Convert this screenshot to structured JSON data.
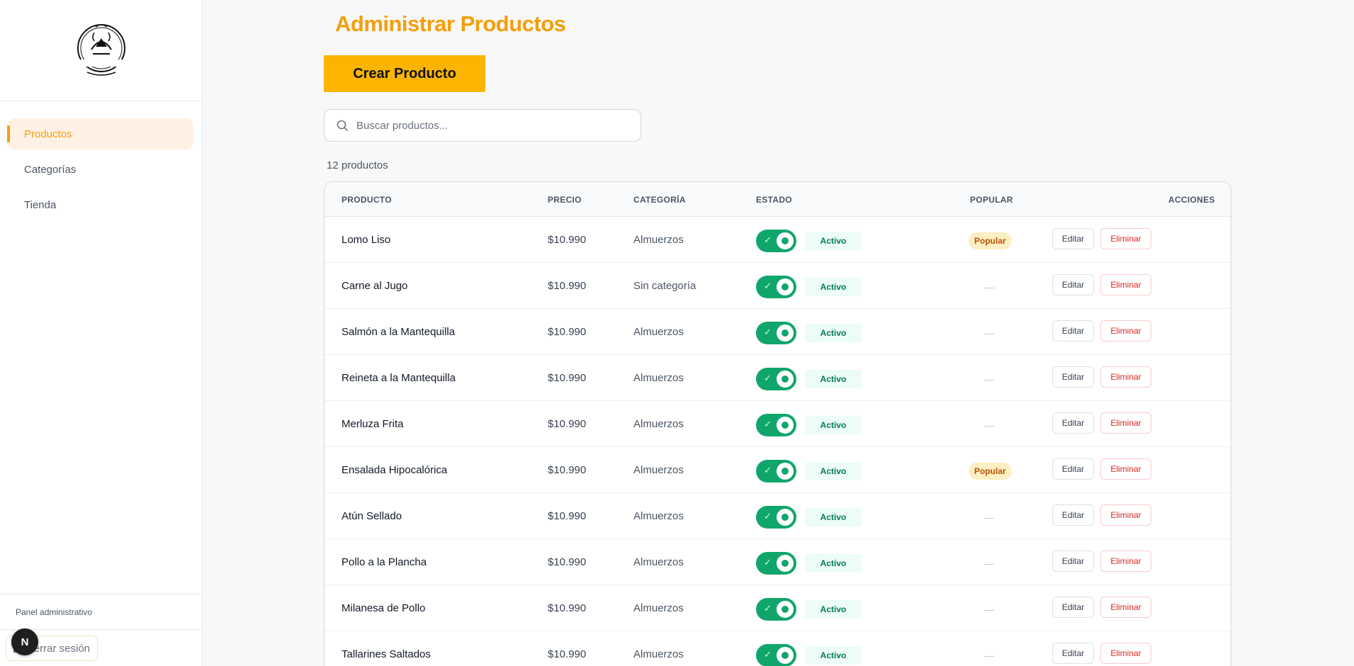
{
  "sidebar": {
    "logo_text": "RESTAURANT & BAR",
    "nav": [
      {
        "label": "Productos",
        "active": true
      },
      {
        "label": "Categorías",
        "active": false
      },
      {
        "label": "Tienda",
        "active": false
      }
    ],
    "footer_label": "Panel administrativo",
    "logout_label": "Cerrar sesión",
    "dev_badge": "N"
  },
  "header": {
    "title": "Administrar Productos",
    "create_label": "Crear Producto"
  },
  "search": {
    "placeholder": "Buscar productos...",
    "value": ""
  },
  "count_label": "12 productos",
  "table": {
    "columns": [
      "PRODUCTO",
      "PRECIO",
      "CATEGORÍA",
      "ESTADO",
      "POPULAR",
      "ACCIONES"
    ],
    "edit_label": "Editar",
    "delete_label": "Eliminar",
    "popular_label": "Popular",
    "empty_mark": "—",
    "rows": [
      {
        "name": "Lomo Liso",
        "price": "$10.990",
        "category": "Almuerzos",
        "status": "Activo",
        "active": true,
        "popular": true
      },
      {
        "name": "Carne al Jugo",
        "price": "$10.990",
        "category": "Sin categoría",
        "status": "Activo",
        "active": true,
        "popular": false
      },
      {
        "name": "Salmón a la Mantequilla",
        "price": "$10.990",
        "category": "Almuerzos",
        "status": "Activo",
        "active": true,
        "popular": false
      },
      {
        "name": "Reineta a la Mantequilla",
        "price": "$10.990",
        "category": "Almuerzos",
        "status": "Activo",
        "active": true,
        "popular": false
      },
      {
        "name": "Merluza Frita",
        "price": "$10.990",
        "category": "Almuerzos",
        "status": "Activo",
        "active": true,
        "popular": false
      },
      {
        "name": "Ensalada Hipocalórica",
        "price": "$10.990",
        "category": "Almuerzos",
        "status": "Activo",
        "active": true,
        "popular": true
      },
      {
        "name": "Atún Sellado",
        "price": "$10.990",
        "category": "Almuerzos",
        "status": "Activo",
        "active": true,
        "popular": false
      },
      {
        "name": "Pollo a la Plancha",
        "price": "$10.990",
        "category": "Almuerzos",
        "status": "Activo",
        "active": true,
        "popular": false
      },
      {
        "name": "Milanesa de Pollo",
        "price": "$10.990",
        "category": "Almuerzos",
        "status": "Activo",
        "active": true,
        "popular": false
      },
      {
        "name": "Tallarines Saltados",
        "price": "$10.990",
        "category": "Almuerzos",
        "status": "Activo",
        "active": true,
        "popular": false
      }
    ]
  },
  "colors": {
    "accent": "#f59e0b",
    "button": "#fbb500",
    "toggle_on": "#10a66b",
    "danger": "#dc2626"
  }
}
